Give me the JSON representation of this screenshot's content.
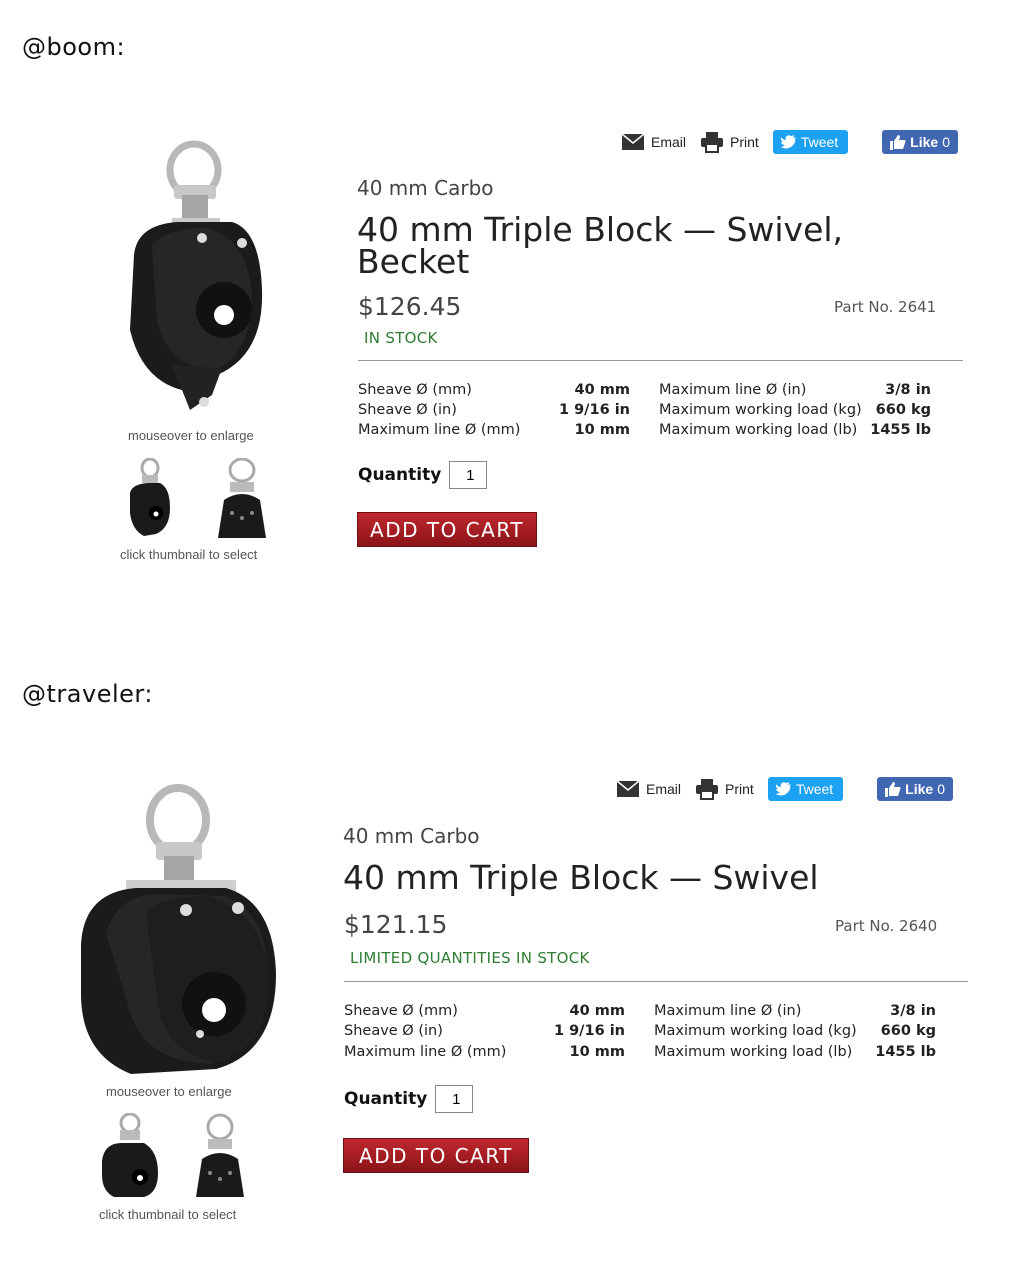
{
  "sections": [
    {
      "label": "@boom:",
      "share": {
        "email": "Email",
        "print": "Print",
        "tweet": "Tweet",
        "like": "Like",
        "like_count": "0"
      },
      "series": "40 mm Carbo",
      "title": "40 mm Triple Block — Swivel, Becket",
      "price": "$126.45",
      "part_no": "Part No. 2641",
      "stock": "IN STOCK",
      "hint_enlarge": "mouseover to enlarge",
      "hint_thumb": "click thumbnail to select",
      "specs_left": [
        {
          "label": "Sheave Ø (mm)",
          "value": "40 mm"
        },
        {
          "label": "Sheave Ø (in)",
          "value": "1 9/16 in"
        },
        {
          "label": "Maximum line Ø (mm)",
          "value": "10 mm"
        }
      ],
      "specs_right": [
        {
          "label": "Maximum line Ø (in)",
          "value": "3/8 in"
        },
        {
          "label": "Maximum working load (kg)",
          "value": "660 kg"
        },
        {
          "label": "Maximum working load (lb)",
          "value": "1455 lb"
        }
      ],
      "quantity_label": "Quantity",
      "quantity_value": "1",
      "add_to_cart": "ADD TO CART"
    },
    {
      "label": "@traveler:",
      "share": {
        "email": "Email",
        "print": "Print",
        "tweet": "Tweet",
        "like": "Like",
        "like_count": "0"
      },
      "series": "40 mm Carbo",
      "title": "40 mm Triple Block — Swivel",
      "price": "$121.15",
      "part_no": "Part No. 2640",
      "stock": "LIMITED QUANTITIES IN STOCK",
      "hint_enlarge": "mouseover to enlarge",
      "hint_thumb": "click thumbnail to select",
      "specs_left": [
        {
          "label": "Sheave Ø (mm)",
          "value": "40 mm"
        },
        {
          "label": "Sheave Ø (in)",
          "value": "1 9/16 in"
        },
        {
          "label": "Maximum line Ø (mm)",
          "value": "10 mm"
        }
      ],
      "specs_right": [
        {
          "label": "Maximum line Ø (in)",
          "value": "3/8 in"
        },
        {
          "label": "Maximum working load (kg)",
          "value": "660 kg"
        },
        {
          "label": "Maximum working load (lb)",
          "value": "1455 lb"
        }
      ],
      "quantity_label": "Quantity",
      "quantity_value": "1",
      "add_to_cart": "ADD TO CART"
    }
  ]
}
